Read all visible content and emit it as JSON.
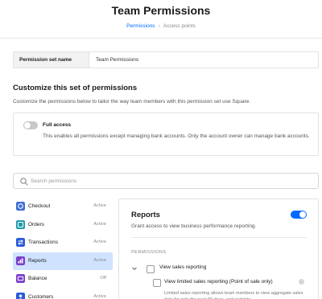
{
  "header": {
    "title": "Team Permissions",
    "breadcrumb": {
      "active": "Permissions",
      "separator": "›",
      "next": "Access points"
    }
  },
  "permission_set": {
    "label": "Permission set name",
    "value": "Team Permissions"
  },
  "customize": {
    "title": "Customize this set of permissions",
    "description": "Customize the permissions below to tailor the way team members with this permission set use Square."
  },
  "full_access": {
    "title": "Full access",
    "description": "This enables all permissions except managing bank accounts. Only the account owner can manage bank accounts.",
    "enabled": false
  },
  "search": {
    "placeholder": "Search permissions",
    "value": ""
  },
  "sidebar": {
    "items": [
      {
        "label": "Checkout",
        "status": "Active",
        "icon": "checkout-icon",
        "color": "#3d6fd6"
      },
      {
        "label": "Orders",
        "status": "Active",
        "icon": "orders-icon",
        "color": "#1f9aa8"
      },
      {
        "label": "Transactions",
        "status": "Active",
        "icon": "transactions-icon",
        "color": "#2a5bd8"
      },
      {
        "label": "Reports",
        "status": "Active",
        "icon": "reports-icon",
        "color": "#7a3fc8",
        "selected": true
      },
      {
        "label": "Balance",
        "status": "Off",
        "icon": "balance-icon",
        "color": "#7a3fc8"
      },
      {
        "label": "Customers",
        "status": "Active",
        "icon": "customers-icon",
        "color": "#2a5bd8"
      }
    ]
  },
  "panel": {
    "title": "Reports",
    "enabled": true,
    "description": "Grant access to view business performance reporting.",
    "heading": "PERMISSIONS",
    "perm1": "View sales reporting",
    "perm2": "View limited sales reporting (Point of sale only)",
    "perm2_desc": "Limited sales reporting allows team members to view aggregate sales data for only the past 90 days, and restricts"
  },
  "colors": {
    "accent": "#006aff",
    "selected_bg": "#cfe3ff"
  }
}
